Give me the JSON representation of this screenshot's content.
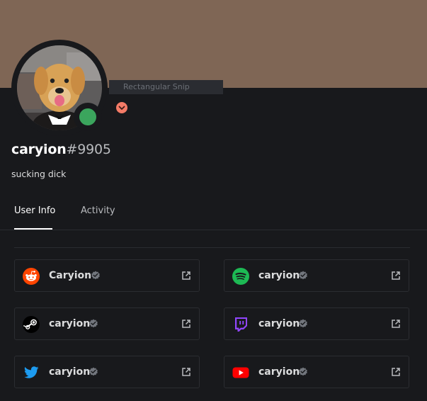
{
  "window": {
    "snip_label": "Rectangular Snip"
  },
  "profile": {
    "username": "caryion",
    "discriminator": "#9905",
    "custom_status": "sucking dick",
    "banner_color": "#7f6655",
    "status": "online",
    "status_color": "#3ba55d"
  },
  "tabs": [
    {
      "label": "User Info",
      "active": true
    },
    {
      "label": "Activity",
      "active": false
    }
  ],
  "connections": [
    {
      "service": "reddit",
      "name": "Caryion",
      "icon": "reddit-icon",
      "color": "#ff4500"
    },
    {
      "service": "spotify",
      "name": "caryion",
      "icon": "spotify-icon",
      "color": "#1db954"
    },
    {
      "service": "steam",
      "name": "caryion",
      "icon": "steam-icon",
      "color": "#000000"
    },
    {
      "service": "twitch",
      "name": "caryion",
      "icon": "twitch-icon",
      "color": "#9146ff"
    },
    {
      "service": "twitter",
      "name": "caryion",
      "icon": "twitter-icon",
      "color": "#1d9bf0"
    },
    {
      "service": "youtube",
      "name": "caryion",
      "icon": "youtube-icon",
      "color": "#ff0000"
    }
  ]
}
